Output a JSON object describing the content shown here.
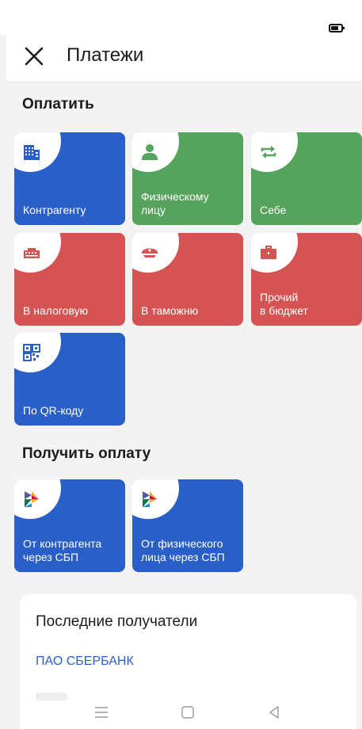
{
  "header": {
    "title": "Платежи",
    "close_icon": "close-icon"
  },
  "pay_section": {
    "title": "Оплатить",
    "tiles": [
      {
        "label": "Контрагенту",
        "color": "#2b5fc8",
        "icon": "building-icon"
      },
      {
        "label": "Физическому\nлицу",
        "color": "#55a35c",
        "icon": "person-icon"
      },
      {
        "label": "Себе",
        "color": "#55a35c",
        "icon": "repeat-arrows-icon"
      },
      {
        "label": "В налоговую",
        "color": "#d65353",
        "icon": "tax-office-icon"
      },
      {
        "label": "В таможню",
        "color": "#d65353",
        "icon": "customs-cap-icon"
      },
      {
        "label": "Прочий\nв бюджет",
        "color": "#d65353",
        "icon": "briefcase-icon"
      },
      {
        "label": "По QR-коду",
        "color": "#2b5fc8",
        "icon": "qr-code-icon"
      }
    ]
  },
  "receive_section": {
    "title": "Получить оплату",
    "tiles": [
      {
        "label": "От контрагента\nчерез СБП",
        "color": "#2b5fc8",
        "icon": "sbp-logo-icon"
      },
      {
        "label": "От физического\nлица через СБП",
        "color": "#2b5fc8",
        "icon": "sbp-logo-icon"
      }
    ]
  },
  "recent": {
    "title": "Последние получатели",
    "items": [
      "ПАО СБЕРБАНК"
    ]
  },
  "navbar": {
    "icons": [
      "menu-icon",
      "home-icon",
      "back-icon"
    ]
  },
  "colors": {
    "blue": "#2b5fc8",
    "green": "#55a35c",
    "red": "#d65353",
    "background": "#f3f3f3"
  }
}
